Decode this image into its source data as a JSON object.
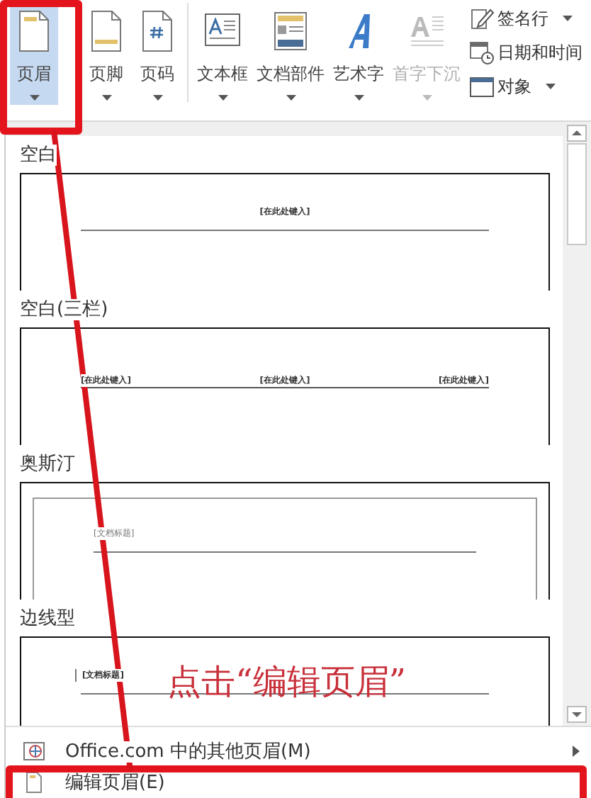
{
  "ribbon": {
    "large_buttons": [
      {
        "label": "页眉",
        "selected": true,
        "disabled": false,
        "dropdown": true
      },
      {
        "label": "页脚",
        "selected": false,
        "disabled": false,
        "dropdown": true
      },
      {
        "label": "页码",
        "selected": false,
        "disabled": false,
        "dropdown": true
      },
      {
        "label": "文本框",
        "selected": false,
        "disabled": false,
        "dropdown": true
      },
      {
        "label": "文档部件",
        "selected": false,
        "disabled": false,
        "dropdown": true
      },
      {
        "label": "艺术字",
        "selected": false,
        "disabled": false,
        "dropdown": true
      },
      {
        "label": "首字下沉",
        "selected": false,
        "disabled": true,
        "dropdown": true
      }
    ],
    "small_buttons": [
      {
        "label": "签名行",
        "dropdown": true
      },
      {
        "label": "日期和时间",
        "dropdown": false
      },
      {
        "label": "对象",
        "dropdown": true
      }
    ]
  },
  "gallery": {
    "items": [
      {
        "name": "空白",
        "kind": "centered",
        "fields": [
          "[在此处键入]"
        ]
      },
      {
        "name": "空白(三栏)",
        "kind": "three",
        "fields": [
          "[在此处键入]",
          "[在此处键入]",
          "[在此处键入]"
        ]
      },
      {
        "name": "奥斯汀",
        "kind": "framed",
        "fields": [
          "[文档标题]"
        ]
      },
      {
        "name": "边线型",
        "kind": "sideline",
        "fields": [
          "[文档标题]"
        ]
      }
    ]
  },
  "menu": [
    {
      "label": "Office.com 中的其他页眉(M)",
      "submenu": true
    },
    {
      "label": "编辑页眉(E)",
      "submenu": false
    }
  ],
  "annotation": {
    "text": "点击“编辑页眉”"
  }
}
